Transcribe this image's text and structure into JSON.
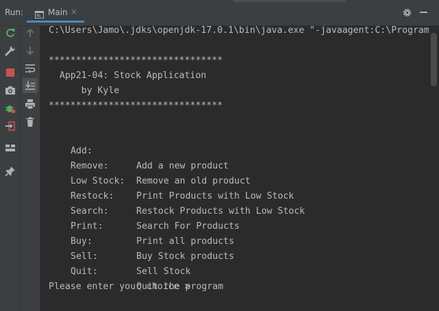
{
  "toolwindow": {
    "run_label": "Run:",
    "tab_label": "Main",
    "tab_close": "×"
  },
  "console": {
    "command_line": "C:\\Users\\Jamo\\.jdks\\openjdk-17.0.1\\bin\\java.exe \"-javaagent:C:\\Program",
    "stars_top": "********************************",
    "app_title": "  App21-04: Stock Application",
    "author": "      by Kyle",
    "stars_bottom": "********************************",
    "menu": [
      {
        "command": "Add:",
        "description": "Add a new product"
      },
      {
        "command": "Remove:",
        "description": "Remove an old product"
      },
      {
        "command": "Low Stock:",
        "description": "Print Products with Low Stock"
      },
      {
        "command": "Restock:",
        "description": "Restock Products with Low Stock"
      },
      {
        "command": "Search:",
        "description": "Search For Products"
      },
      {
        "command": "Print:",
        "description": "Print all products"
      },
      {
        "command": "Buy:",
        "description": "Buy Stock products"
      },
      {
        "command": "Sell:",
        "description": "Sell Stock"
      },
      {
        "command": "Quit:",
        "description": "Quit the program"
      }
    ],
    "prompt": "Please enter your choice >"
  },
  "colors": {
    "console_bg": "#2b2b2b",
    "panel_bg": "#3c3f41",
    "text": "#bbbbbb",
    "rerun_green": "#59a869",
    "stop_red": "#c75450",
    "tab_underline": "#4a88c7"
  },
  "icons": {
    "rerun": "rerun-icon",
    "wrench": "wrench-icon",
    "stop": "stop-icon",
    "camera": "camera-icon",
    "debug": "debug-icon",
    "exit": "exit-icon",
    "layout": "layout-icon",
    "pin": "pin-icon",
    "up": "arrow-up-icon",
    "down": "arrow-down-icon",
    "softwrap": "soft-wrap-icon",
    "scroll_end": "scroll-to-end-icon",
    "print": "print-icon",
    "trash": "trash-icon",
    "settings": "gear-icon",
    "hide": "minimize-icon"
  }
}
